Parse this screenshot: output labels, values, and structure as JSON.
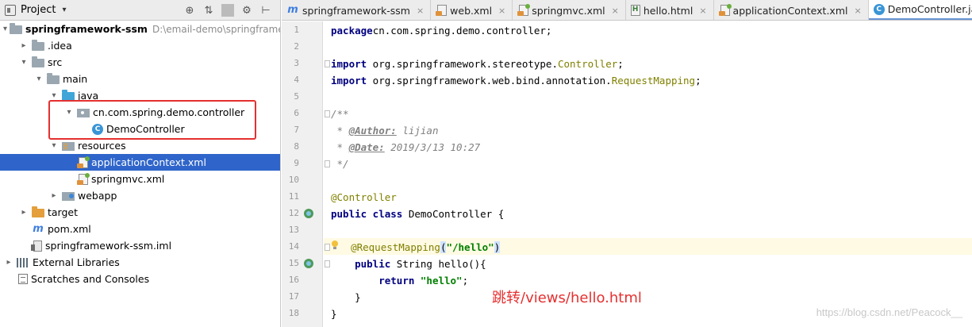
{
  "panel": {
    "title": "Project",
    "caret": "▾",
    "tools": [
      "⊕",
      "⇅",
      "⚙",
      "⊢"
    ]
  },
  "tree": [
    {
      "label": "springframework-ssm",
      "path": "D:\\email-demo\\springframew",
      "depth": 0,
      "arrow": "▾",
      "icon": "folder-gray",
      "bold": true
    },
    {
      "label": ".idea",
      "depth": 1,
      "arrow": "▸",
      "icon": "folder-gray"
    },
    {
      "label": "src",
      "depth": 1,
      "arrow": "▾",
      "icon": "folder-gray"
    },
    {
      "label": "main",
      "depth": 2,
      "arrow": "▾",
      "icon": "folder-gray"
    },
    {
      "label": "java",
      "depth": 3,
      "arrow": "▾",
      "icon": "folder-blue"
    },
    {
      "label": "cn.com.spring.demo.controller",
      "depth": 4,
      "arrow": "▾",
      "icon": "pkg-icon"
    },
    {
      "label": "DemoController",
      "depth": 5,
      "arrow": "",
      "icon": "class-icon"
    },
    {
      "label": "resources",
      "depth": 3,
      "arrow": "▾",
      "icon": "folder-res"
    },
    {
      "label": "applicationContext.xml",
      "depth": 4,
      "arrow": "",
      "icon": "xml-spring",
      "selected": true
    },
    {
      "label": "springmvc.xml",
      "depth": 4,
      "arrow": "",
      "icon": "xml-spring"
    },
    {
      "label": "webapp",
      "depth": 3,
      "arrow": "▸",
      "icon": "folder-web"
    },
    {
      "label": "target",
      "depth": 1,
      "arrow": "▸",
      "icon": "folder-orange"
    },
    {
      "label": "pom.xml",
      "depth": 1,
      "arrow": "",
      "icon": "maven-icon"
    },
    {
      "label": "springframework-ssm.iml",
      "depth": 1,
      "arrow": "",
      "icon": "iml-icon"
    },
    {
      "label": "External Libraries",
      "depth": 0,
      "arrow": "▸",
      "icon": "libs-icon"
    },
    {
      "label": "Scratches and Consoles",
      "depth": 0,
      "arrow": "",
      "icon": "scratch-icon"
    }
  ],
  "tabs": [
    {
      "label": "springframework-ssm",
      "icon": "maven-icon"
    },
    {
      "label": "web.xml",
      "icon": "xml-icon"
    },
    {
      "label": "springmvc.xml",
      "icon": "xml-spring"
    },
    {
      "label": "hello.html",
      "icon": "html-icon"
    },
    {
      "label": "applicationContext.xml",
      "icon": "xml-spring"
    },
    {
      "label": "DemoController.java",
      "icon": "class-icon",
      "active": true
    }
  ],
  "code": [
    [
      [
        "kw",
        "package"
      ],
      [
        "",
        "cn.com.spring.demo.controller;"
      ]
    ],
    [],
    [
      [
        "kw",
        "import"
      ],
      [
        "",
        " org.springframework.stereotype."
      ],
      [
        "cls",
        "Controller"
      ],
      [
        "",
        ";"
      ]
    ],
    [
      [
        "kw",
        "import"
      ],
      [
        "",
        " org.springframework.web.bind.annotation."
      ],
      [
        "cls",
        "RequestMapping"
      ],
      [
        "",
        ";"
      ]
    ],
    [],
    [
      [
        "cmt",
        "/**"
      ]
    ],
    [
      [
        "cmt",
        " * "
      ],
      [
        "tag",
        "@Author:"
      ],
      [
        "cmt",
        " lijian"
      ]
    ],
    [
      [
        "cmt",
        " * "
      ],
      [
        "tag",
        "@Date:"
      ],
      [
        "cmt",
        " 2019/3/13 10:27"
      ]
    ],
    [
      [
        "cmt",
        " */"
      ]
    ],
    [],
    [
      [
        "ann",
        "@Controller"
      ]
    ],
    [
      [
        "kw",
        "public class"
      ],
      [
        "",
        " DemoController {"
      ]
    ],
    [],
    [
      [
        "",
        ""
      ],
      [
        "bulb",
        ""
      ],
      [
        "",
        "  "
      ],
      [
        "ann",
        "@RequestMapping"
      ],
      [
        "brace-hl",
        "("
      ],
      [
        "str",
        "\"/hello\""
      ],
      [
        "brace-hl",
        ")"
      ]
    ],
    [
      [
        "",
        "    "
      ],
      [
        "kw",
        "public"
      ],
      [
        "",
        " String hello(){"
      ]
    ],
    [
      [
        "",
        "        "
      ],
      [
        "kw",
        "return"
      ],
      [
        "",
        " "
      ],
      [
        "str",
        "\"hello\""
      ],
      [
        "",
        ";"
      ]
    ],
    [
      [
        "",
        "    }"
      ]
    ],
    [
      [
        "",
        "}"
      ]
    ]
  ],
  "gutter_marks": [
    12,
    15
  ],
  "annotation_text": "跳转/views/hello.html",
  "watermark": "https://blog.csdn.net/Peacock__"
}
